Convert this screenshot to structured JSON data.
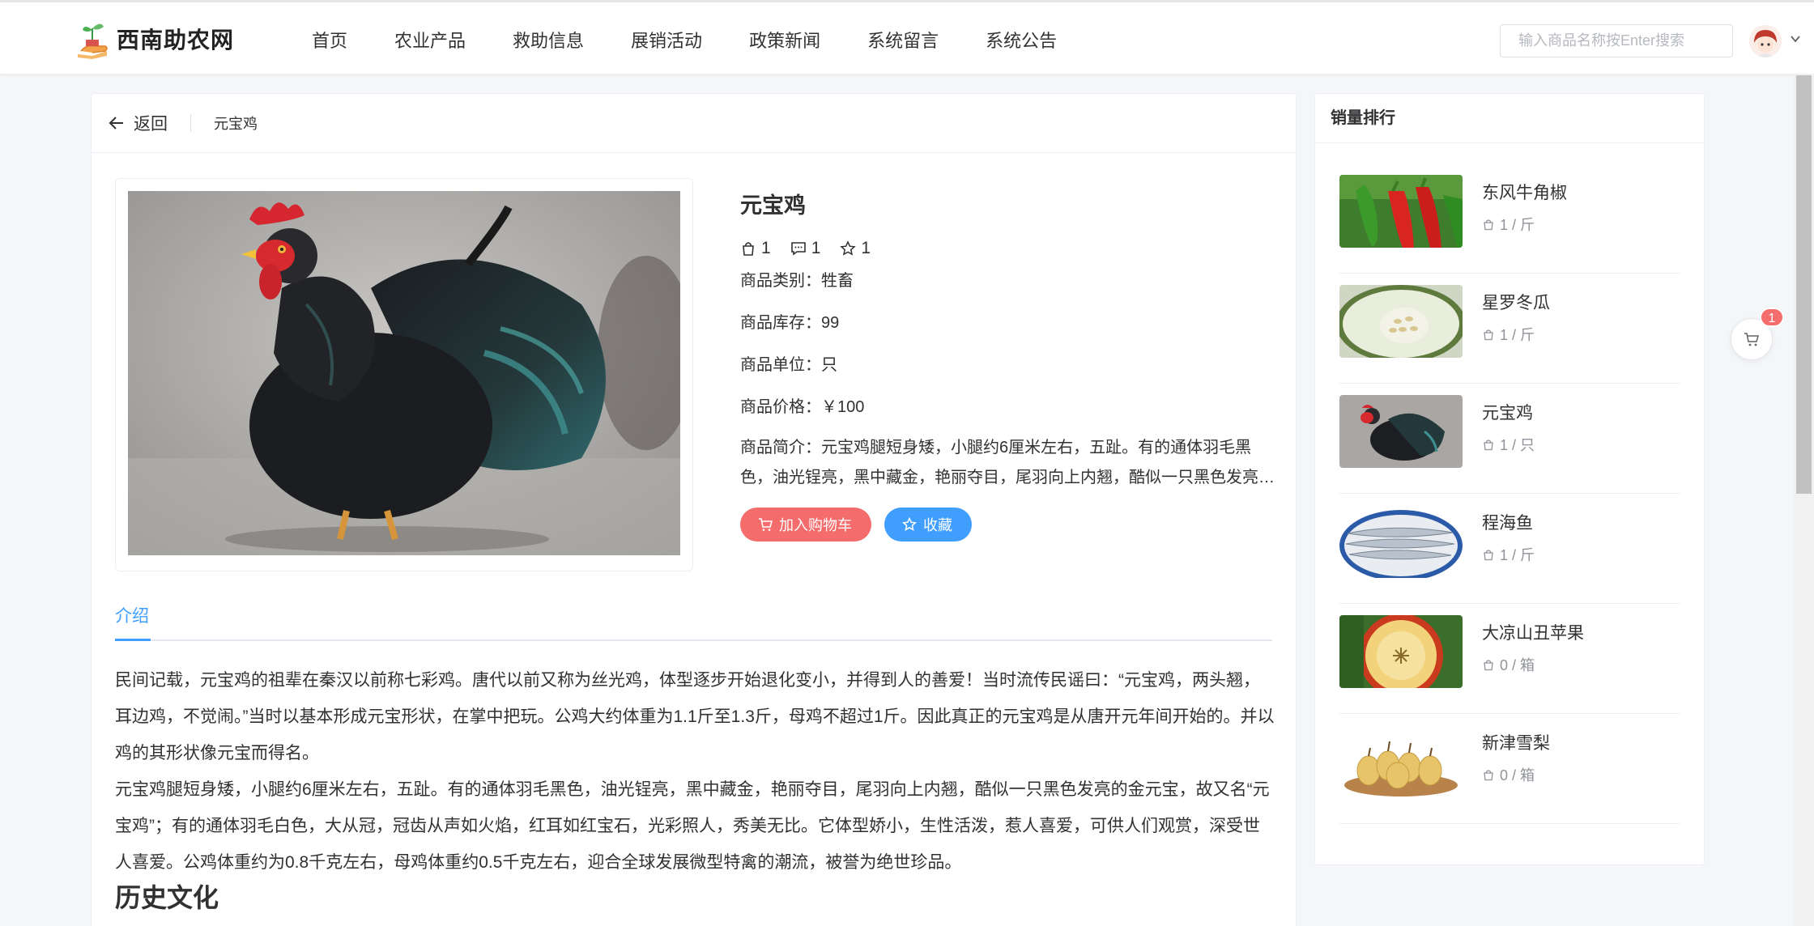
{
  "site": {
    "name": "西南助农网"
  },
  "nav": [
    "首页",
    "农业产品",
    "救助信息",
    "展销活动",
    "政策新闻",
    "系统留言",
    "系统公告"
  ],
  "search": {
    "placeholder": "输入商品名称按Enter搜索",
    "value": ""
  },
  "header": {
    "back_label": "返回",
    "breadcrumb": "元宝鸡"
  },
  "product": {
    "title": "元宝鸡",
    "sales": "1",
    "comments": "1",
    "favorites": "1",
    "category": "商品类别：牲畜",
    "stock": "商品库存：99",
    "unit": "商品单位：只",
    "price": "商品价格：￥100",
    "intro": "商品简介：元宝鸡腿短身矮，小腿约6厘米左右，五趾。有的通体羽毛黑色，油光锃亮，黑中藏金，艳丽夺目，尾羽向上内翘，酷似一只黑色发亮的金元宝，故又名“元宝鸡”"
  },
  "actions": {
    "add_cart": "加入购物车",
    "favorite": "收藏"
  },
  "tabs": {
    "active": "介绍"
  },
  "description": [
    "民间记载，元宝鸡的祖辈在秦汉以前称七彩鸡。唐代以前又称为丝光鸡，体型逐步开始退化变小，并得到人的善爱！当时流传民谣曰：“元宝鸡，两头翘，耳边鸡，不觉闹。”当时以基本形成元宝形状，在掌中把玩。公鸡大约体重为1.1斤至1.3斤，母鸡不超过1斤。因此真正的元宝鸡是从唐开元年间开始的。并以鸡的其形状像元宝而得名。",
    "元宝鸡腿短身矮，小腿约6厘米左右，五趾。有的通体羽毛黑色，油光锃亮，黑中藏金，艳丽夺目，尾羽向上内翘，酷似一只黑色发亮的金元宝，故又名“元宝鸡”；有的通体羽毛白色，大从冠，冠齿从声如火焰，红耳如红宝石，光彩照人，秀美无比。它体型娇小，生性活泼，惹人喜爱，可供人们观赏，深受世人喜爱。公鸡体重约为0.8千克左右，母鸡体重约0.5千克左右，迎合全球发展微型特禽的潮流，被誉为绝世珍品。"
  ],
  "section_heading": "历史文化",
  "ranking": {
    "title": "销量排行",
    "items": [
      {
        "name": "东风牛角椒",
        "meta": "1 / 斤"
      },
      {
        "name": "星罗冬瓜",
        "meta": "1 / 斤"
      },
      {
        "name": "元宝鸡",
        "meta": "1 / 只"
      },
      {
        "name": "程海鱼",
        "meta": "1 / 斤"
      },
      {
        "name": "大凉山丑苹果",
        "meta": "0 / 箱"
      },
      {
        "name": "新津雪梨",
        "meta": "0 / 箱"
      }
    ]
  },
  "cart": {
    "badge": "1"
  },
  "colors": {
    "primary": "#409eff",
    "danger": "#f56c6c",
    "text": "#303133",
    "muted": "#909399"
  }
}
